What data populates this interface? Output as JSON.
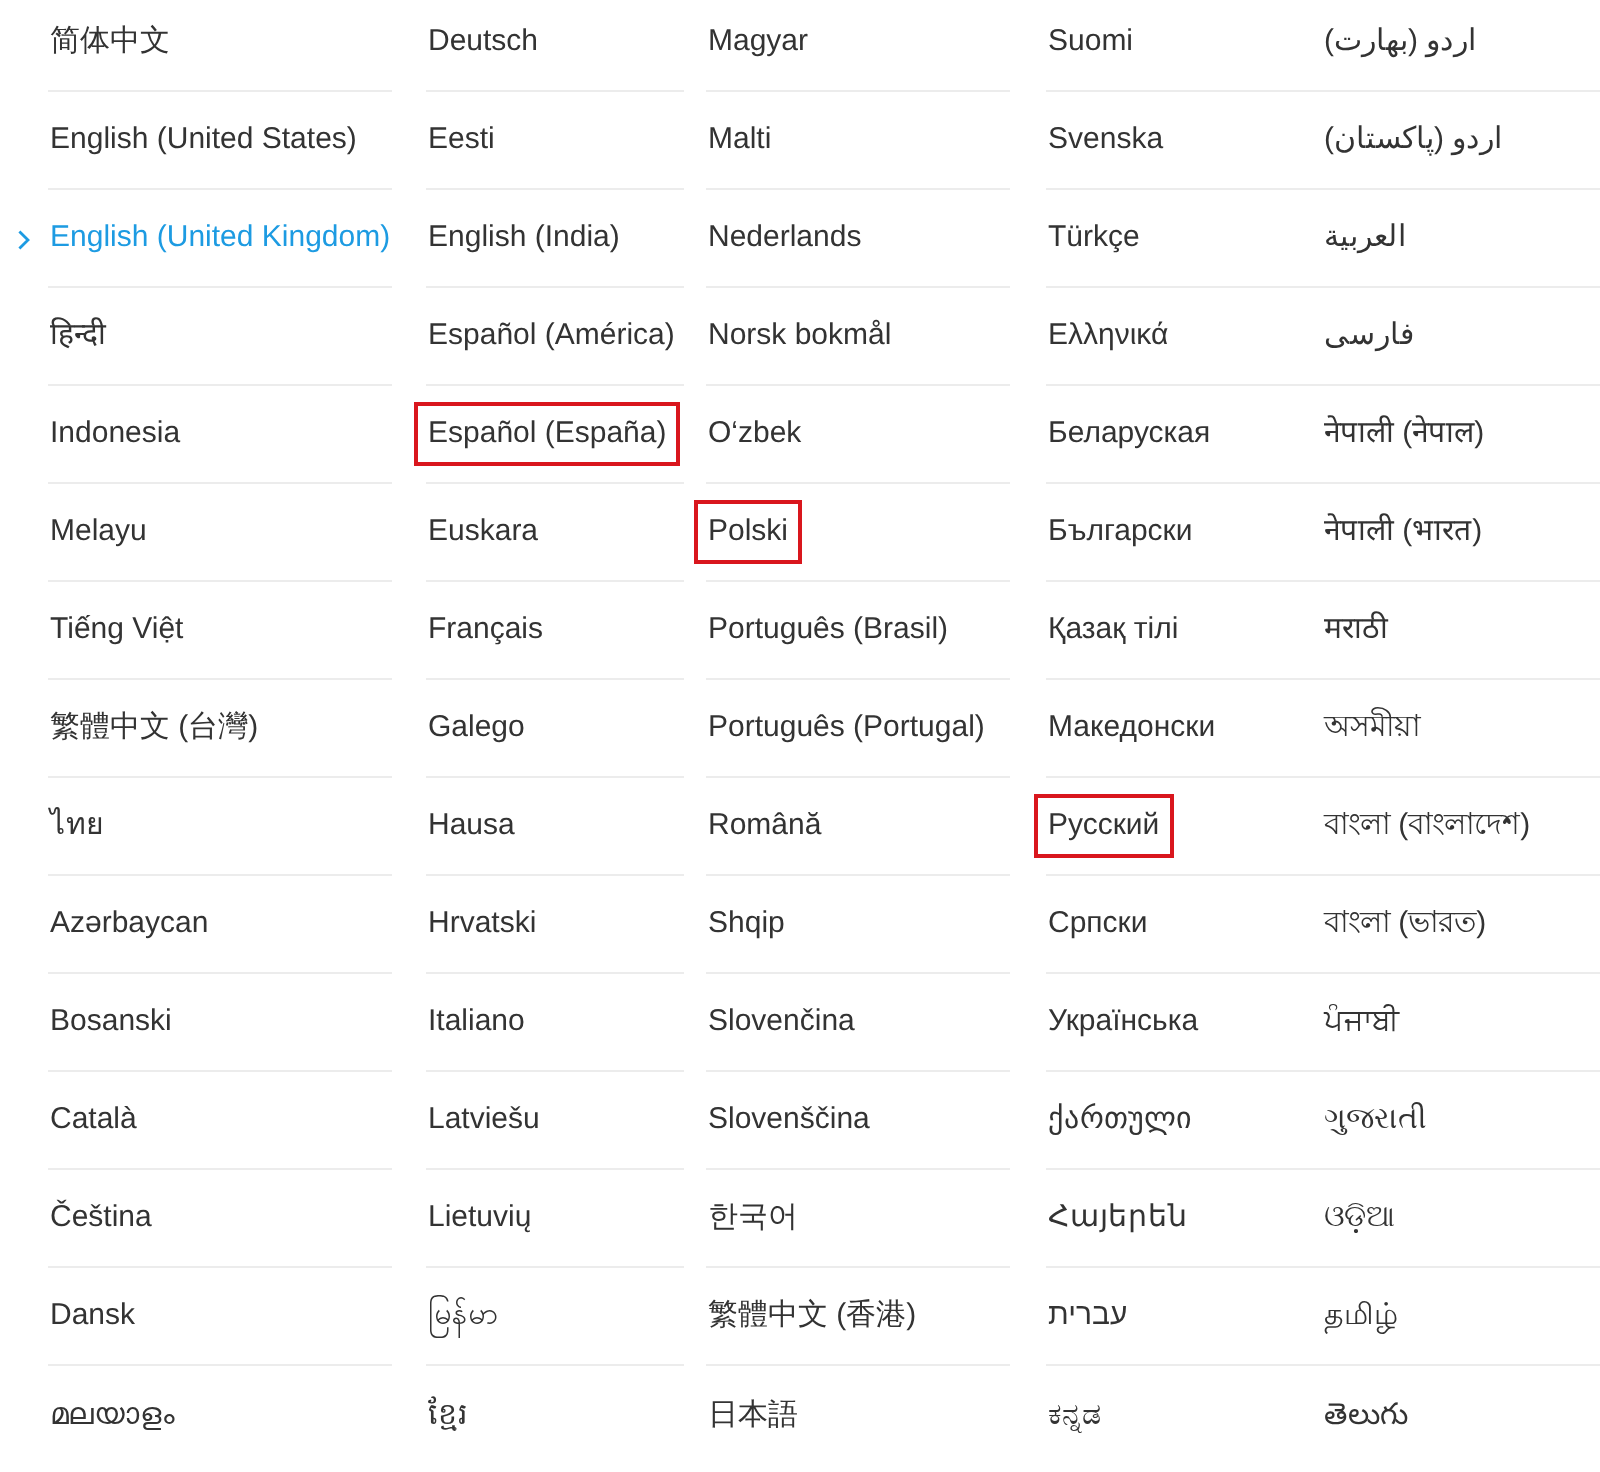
{
  "columns": [
    {
      "items": [
        {
          "label": "简体中文",
          "selected": false,
          "marked": false
        },
        {
          "label": "English (United States)",
          "selected": false,
          "marked": false
        },
        {
          "label": "English (United Kingdom)",
          "selected": true,
          "marked": false
        },
        {
          "label": "हिन्दी",
          "selected": false,
          "marked": false
        },
        {
          "label": "Indonesia",
          "selected": false,
          "marked": false
        },
        {
          "label": "Melayu",
          "selected": false,
          "marked": false
        },
        {
          "label": "Tiếng Việt",
          "selected": false,
          "marked": false
        },
        {
          "label": "繁體中文 (台灣)",
          "selected": false,
          "marked": false
        },
        {
          "label": "ไทย",
          "selected": false,
          "marked": false
        },
        {
          "label": "Azərbaycan",
          "selected": false,
          "marked": false
        },
        {
          "label": "Bosanski",
          "selected": false,
          "marked": false
        },
        {
          "label": "Català",
          "selected": false,
          "marked": false
        },
        {
          "label": "Čeština",
          "selected": false,
          "marked": false
        },
        {
          "label": "Dansk",
          "selected": false,
          "marked": false
        },
        {
          "label": "മലയാളം",
          "selected": false,
          "marked": false
        }
      ]
    },
    {
      "items": [
        {
          "label": "Deutsch",
          "selected": false,
          "marked": false
        },
        {
          "label": "Eesti",
          "selected": false,
          "marked": false
        },
        {
          "label": "English (India)",
          "selected": false,
          "marked": false
        },
        {
          "label": "Español (América)",
          "selected": false,
          "marked": false
        },
        {
          "label": "Español (España)",
          "selected": false,
          "marked": true
        },
        {
          "label": "Euskara",
          "selected": false,
          "marked": false
        },
        {
          "label": "Français",
          "selected": false,
          "marked": false
        },
        {
          "label": "Galego",
          "selected": false,
          "marked": false
        },
        {
          "label": "Hausa",
          "selected": false,
          "marked": false
        },
        {
          "label": "Hrvatski",
          "selected": false,
          "marked": false
        },
        {
          "label": "Italiano",
          "selected": false,
          "marked": false
        },
        {
          "label": "Latviešu",
          "selected": false,
          "marked": false
        },
        {
          "label": "Lietuvių",
          "selected": false,
          "marked": false
        },
        {
          "label": "မြန်မာ",
          "selected": false,
          "marked": false
        },
        {
          "label": "ខ្មែរ",
          "selected": false,
          "marked": false
        }
      ]
    },
    {
      "items": [
        {
          "label": "Magyar",
          "selected": false,
          "marked": false
        },
        {
          "label": "Malti",
          "selected": false,
          "marked": false
        },
        {
          "label": "Nederlands",
          "selected": false,
          "marked": false
        },
        {
          "label": "Norsk bokmål",
          "selected": false,
          "marked": false
        },
        {
          "label": "O‘zbek",
          "selected": false,
          "marked": false
        },
        {
          "label": "Polski",
          "selected": false,
          "marked": true
        },
        {
          "label": "Português (Brasil)",
          "selected": false,
          "marked": false
        },
        {
          "label": "Português (Portugal)",
          "selected": false,
          "marked": false
        },
        {
          "label": "Română",
          "selected": false,
          "marked": false
        },
        {
          "label": "Shqip",
          "selected": false,
          "marked": false
        },
        {
          "label": "Slovenčina",
          "selected": false,
          "marked": false
        },
        {
          "label": "Slovenščina",
          "selected": false,
          "marked": false
        },
        {
          "label": "한국어",
          "selected": false,
          "marked": false
        },
        {
          "label": "繁體中文 (香港)",
          "selected": false,
          "marked": false
        },
        {
          "label": "日本語",
          "selected": false,
          "marked": false
        }
      ]
    },
    {
      "items": [
        {
          "label": "Suomi",
          "selected": false,
          "marked": false
        },
        {
          "label": "Svenska",
          "selected": false,
          "marked": false
        },
        {
          "label": "Türkçe",
          "selected": false,
          "marked": false
        },
        {
          "label": "Ελληνικά",
          "selected": false,
          "marked": false
        },
        {
          "label": "Беларуская",
          "selected": false,
          "marked": false
        },
        {
          "label": "Български",
          "selected": false,
          "marked": false
        },
        {
          "label": "Қазақ тілі",
          "selected": false,
          "marked": false
        },
        {
          "label": "Македонски",
          "selected": false,
          "marked": false
        },
        {
          "label": "Русский",
          "selected": false,
          "marked": true
        },
        {
          "label": "Српски",
          "selected": false,
          "marked": false
        },
        {
          "label": "Українська",
          "selected": false,
          "marked": false
        },
        {
          "label": "ქართული",
          "selected": false,
          "marked": false
        },
        {
          "label": "Հայերեն",
          "selected": false,
          "marked": false
        },
        {
          "label": "עברית",
          "selected": false,
          "marked": false
        },
        {
          "label": "ಕನ್ನಡ",
          "selected": false,
          "marked": false
        }
      ]
    },
    {
      "items": [
        {
          "label": "اردو (بھارت)",
          "selected": false,
          "marked": false
        },
        {
          "label": "اردو (پاکستان)",
          "selected": false,
          "marked": false
        },
        {
          "label": "العربية",
          "selected": false,
          "marked": false
        },
        {
          "label": "فارسی",
          "selected": false,
          "marked": false
        },
        {
          "label": "नेपाली (नेपाल)",
          "selected": false,
          "marked": false
        },
        {
          "label": "नेपाली (भारत)",
          "selected": false,
          "marked": false
        },
        {
          "label": "मराठी",
          "selected": false,
          "marked": false
        },
        {
          "label": "অসমীয়া",
          "selected": false,
          "marked": false
        },
        {
          "label": "বাংলা (বাংলাদেশ)",
          "selected": false,
          "marked": false
        },
        {
          "label": "বাংলা (ভারত)",
          "selected": false,
          "marked": false
        },
        {
          "label": "ਪੰਜਾਬੀ",
          "selected": false,
          "marked": false
        },
        {
          "label": "ગુજરાતી",
          "selected": false,
          "marked": false
        },
        {
          "label": "ଓଡ଼ିଆ",
          "selected": false,
          "marked": false
        },
        {
          "label": "தமிழ்",
          "selected": false,
          "marked": false
        },
        {
          "label": "తెలుగు",
          "selected": false,
          "marked": false
        }
      ]
    }
  ]
}
